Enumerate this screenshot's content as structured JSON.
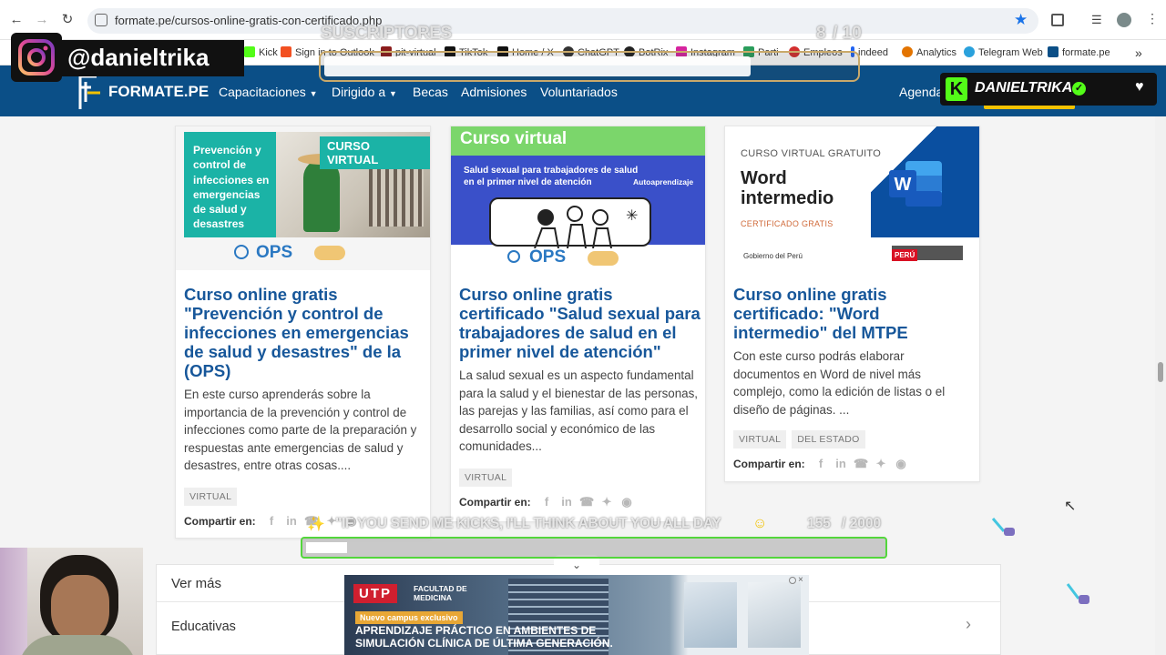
{
  "browser": {
    "url": "formate.pe/cursos-online-gratis-con-certificado.php",
    "bookmarks": [
      "Kick",
      "Sign in to Outlook",
      "pit-virtual",
      "TikTok",
      "Home / X",
      "ChatGPT",
      "BotRix",
      "Instagram",
      "Parti",
      "Empleos",
      "indeed",
      "Analytics",
      "Telegram Web",
      "formate.pe"
    ]
  },
  "site": {
    "logo": "FORMATE.PE",
    "nav": [
      "Capacitaciones",
      "Dirigido a",
      "Becas",
      "Admisiones",
      "Voluntariados"
    ],
    "nav_right": "Agenda"
  },
  "cards": [
    {
      "banner_lines": [
        "Prevención y",
        "control de",
        "infecciones en",
        "emergencias",
        "de salud y",
        "desastres"
      ],
      "badge": "CURSO VIRTUAL",
      "org": "OPS",
      "title": "Curso online gratis \"Prevención y control de infecciones en emergencias de salud y desastres\" de la (OPS)",
      "desc": "En este curso aprenderás sobre la importancia de la prevención y control de infecciones como parte de la preparación y respuestas ante emergencias de salud y desastres, entre otras cosas....",
      "tags": [
        "VIRTUAL"
      ],
      "share_label": "Compartir en:"
    },
    {
      "banner_title": "Curso virtual",
      "banner_sub": "Salud sexual para trabajadores de salud en el primer nivel de atención",
      "banner_badge": "Autoaprendizaje",
      "org": "OPS",
      "title": "Curso online gratis certificado \"Salud sexual para trabajadores de salud en el primer nivel de atención\"",
      "desc": "La salud sexual es un aspecto fundamental para la salud y el bienestar de las personas, las parejas y las familias, así como para el desarrollo social y económico de las comunidades...",
      "tags": [
        "VIRTUAL"
      ],
      "share_label": "Compartir en:"
    },
    {
      "banner_kicker": "CURSO VIRTUAL GRATUITO",
      "banner_title_1": "Word",
      "banner_title_2": "intermedio",
      "banner_cert": "CERTIFICADO GRATIS",
      "banner_gov": "Gobierno del Perú",
      "banner_peru": "PERÚ",
      "title": "Curso online gratis certificado: \"Word intermedio\" del MTPE",
      "desc": "Con este curso podrás elaborar documentos en Word de nivel más complejo, como la edición de listas o el diseño de páginas. ...",
      "tags": [
        "VIRTUAL",
        "DEL ESTADO"
      ],
      "share_label": "Compartir en:"
    }
  ],
  "more": {
    "header": "Ver más",
    "item": "Educativas"
  },
  "ad": {
    "brand": "UTP",
    "faculty_1": "FACULTAD DE",
    "faculty_2": "MEDICINA",
    "pill": "Nuevo campus exclusivo",
    "line1": "APRENDIZAJE PRÁCTICO EN AMBIENTES DE",
    "line2": "SIMULACIÓN CLÍNICA DE ÚLTIMA GENERACIÓN."
  },
  "stream": {
    "instagram_handle": "@danieltrika",
    "subs_label": "SUSCRIPTORES",
    "subs_count": "8",
    "subs_goal": "/ 10",
    "kick_name": "DANIELTRIKA",
    "goal_text": "\"IF YOU SEND ME KICKS, I'LL THINK ABOUT YOU ALL DAY",
    "goal_count": "155",
    "goal_total": "/ 2000"
  },
  "colors": {
    "site_nav": "#0b4f87",
    "card_title": "#17579a",
    "kick_green": "#53fc18"
  }
}
